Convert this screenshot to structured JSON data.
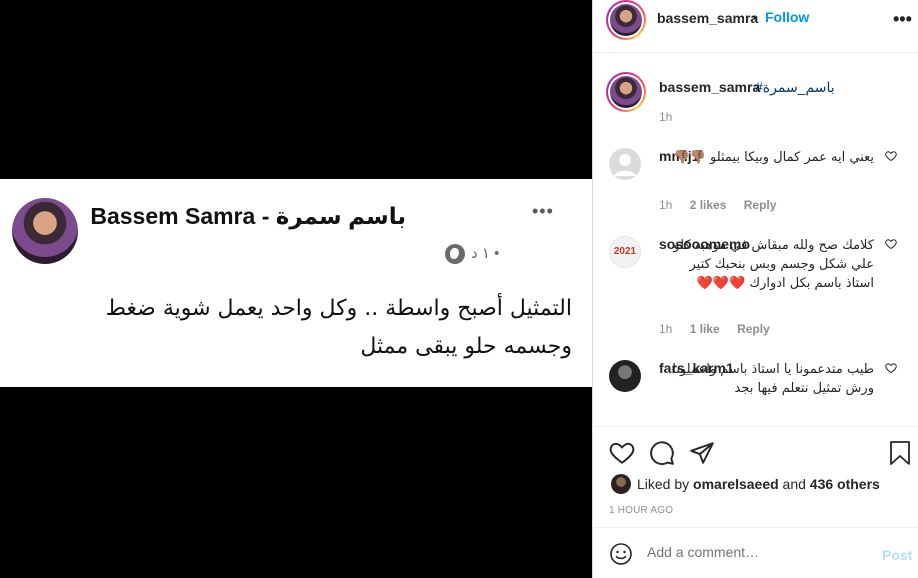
{
  "post": {
    "author_name": "Bassem Samra - باسم سمرة",
    "meta": "١ د •",
    "text": "التمثيل أصبح واسطة .. وكل واحد يعمل شوية ضغط وجسمه حلو يبقى ممثل",
    "more": "•••"
  },
  "header": {
    "username": "bassem_samra",
    "dot": "•",
    "follow_label": "Follow",
    "more": "•••"
  },
  "caption": {
    "username": "bassem_samra",
    "hashtag": "#باسم_سمرة",
    "time": "1h"
  },
  "comments": [
    {
      "username": "mm.j1",
      "text": "يعني ايه عمر كمال وبيكا بيمثلو 👎🏽👎🏽",
      "time": "1h",
      "likes": "2 likes",
      "reply": "Reply"
    },
    {
      "username": "sosooomemo",
      "text": "كلامك صح ولله مبقاش في موهبه كلو علي شكل وجسم وبس بنحبك كتير استاذ باسم بكل ادوارك ❤️❤️❤️",
      "time": "1h",
      "likes": "1 like",
      "reply": "Reply",
      "avatar_label": "2021"
    },
    {
      "username": "fars_karm1",
      "text": "طيب متدعمونا يا استاذ باسم واعملونا ورش تمثيل نتعلم فيها بجد"
    }
  ],
  "likes": {
    "prefix": "Liked by",
    "user": "omarelsaeed",
    "and": "and",
    "others": "436 others"
  },
  "time_ago": "1 HOUR AGO",
  "add_comment": {
    "placeholder": "Add a comment…",
    "post_label": "Post"
  },
  "icons": [
    "heart-icon",
    "comment-icon",
    "share-icon",
    "bookmark-icon",
    "emoji-icon",
    "globe-icon",
    "more-icon"
  ],
  "colors": {
    "follow": "#0095f6",
    "hashtag": "#00376b",
    "post_disabled": "#b2dffc",
    "heart_red": "#ed4956"
  }
}
